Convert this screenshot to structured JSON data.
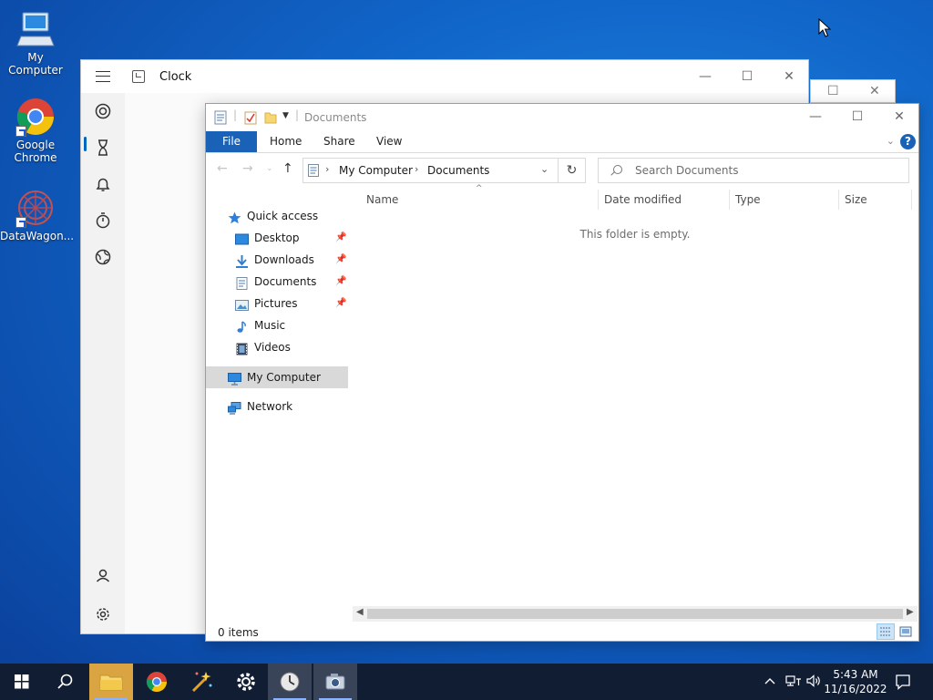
{
  "desktop": {
    "icons": [
      {
        "label": "My Computer"
      },
      {
        "label": "Google Chrome"
      },
      {
        "label": "DataWagon..."
      }
    ]
  },
  "clock_window": {
    "title": "Clock",
    "buttons": {
      "minimize": "—",
      "maximize": "☐",
      "close": "✕"
    }
  },
  "back_window": {
    "buttons": {
      "maximize": "☐",
      "close": "✕"
    }
  },
  "explorer": {
    "title": "Documents",
    "buttons": {
      "minimize": "—",
      "maximize": "☐",
      "close": "✕"
    },
    "ribbon_tabs": [
      "File",
      "Home",
      "Share",
      "View"
    ],
    "help": "?",
    "address": {
      "crumbs": [
        "My Computer",
        "Documents"
      ],
      "sep": "›"
    },
    "search_placeholder": "Search Documents",
    "nav": {
      "quick_access": "Quick access",
      "items": [
        {
          "label": "Desktop",
          "pinned": true
        },
        {
          "label": "Downloads",
          "pinned": true
        },
        {
          "label": "Documents",
          "pinned": true
        },
        {
          "label": "Pictures",
          "pinned": true
        },
        {
          "label": "Music",
          "pinned": false
        },
        {
          "label": "Videos",
          "pinned": false
        }
      ],
      "my_computer": "My Computer",
      "network": "Network"
    },
    "columns": [
      "Name",
      "Date modified",
      "Type",
      "Size"
    ],
    "empty_message": "This folder is empty.",
    "status": "0 items"
  },
  "taskbar": {
    "time": "5:43 AM",
    "date": "11/16/2022"
  },
  "colors": {
    "accent": "#1a62b8",
    "taskbar": "#111d33",
    "desktop": "#1166c9"
  }
}
